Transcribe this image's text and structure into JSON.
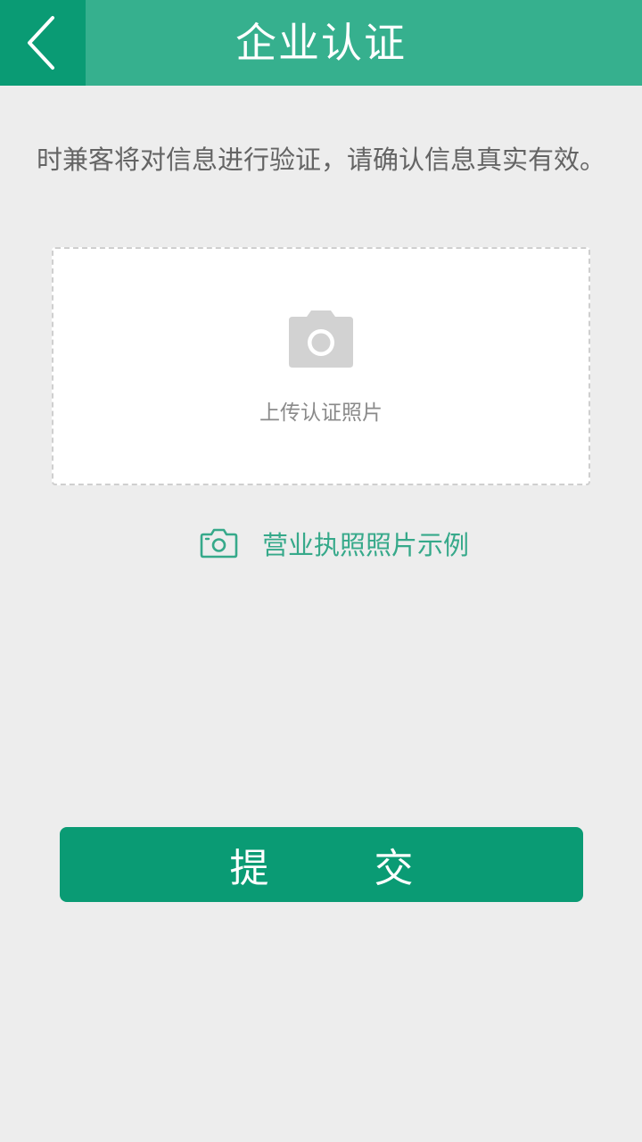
{
  "header": {
    "title": "企业认证",
    "back_icon": "chevron-left-icon",
    "background_color": "#36b08e",
    "back_background_color": "#0a9b74"
  },
  "notice": {
    "text": "时兼客将对信息进行验证，请确认信息真实有效。"
  },
  "upload": {
    "icon": "camera-icon",
    "label": "上传认证照片"
  },
  "example": {
    "icon": "camera-outline-icon",
    "label": "营业执照照片示例",
    "color": "#36a98a"
  },
  "submit": {
    "char1": "提",
    "char2": "交",
    "background_color": "#0a9b74"
  }
}
